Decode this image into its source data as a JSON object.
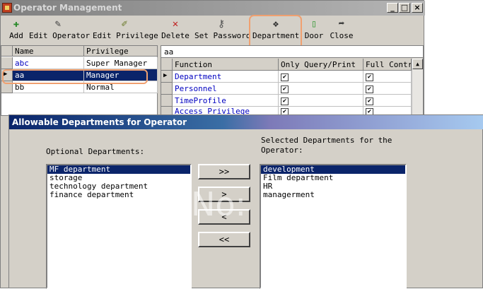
{
  "window": {
    "title": "Operator Management",
    "controls": [
      "_",
      "□",
      "×"
    ]
  },
  "toolbar": [
    {
      "label": "Add",
      "icon": "add-icon",
      "glyph": "✚"
    },
    {
      "label": "Edit Operator",
      "icon": "edit-operator-icon",
      "glyph": "✎"
    },
    {
      "label": "Edit Privilege",
      "icon": "edit-privilege-icon",
      "glyph": "✐"
    },
    {
      "label": "Delete",
      "icon": "delete-icon",
      "glyph": "✕"
    },
    {
      "label": "Set Password",
      "icon": "key-icon",
      "glyph": "⚷"
    },
    {
      "label": "Department",
      "icon": "department-icon",
      "glyph": "❖"
    },
    {
      "label": "Door",
      "icon": "door-icon",
      "glyph": "▯"
    },
    {
      "label": "Close",
      "icon": "close-arrow-icon",
      "glyph": "➦"
    }
  ],
  "operators": {
    "columns": [
      "Name",
      "Privilege"
    ],
    "rows": [
      {
        "name": "abc",
        "privilege": "Super Manager"
      },
      {
        "name": "aa",
        "privilege": "Manager"
      },
      {
        "name": "bb",
        "privilege": "Normal"
      }
    ]
  },
  "permissions": {
    "operator": "aa",
    "columns": [
      "Function",
      "Only Query/Print",
      "Full Control"
    ],
    "rows": [
      {
        "function": "Department",
        "query": "✔",
        "full": "✔"
      },
      {
        "function": "Personnel",
        "query": "✔",
        "full": "✔"
      },
      {
        "function": "TimeProfile",
        "query": "✔",
        "full": "✔"
      },
      {
        "function": "Access Privilege",
        "query": "✔",
        "full": "✔"
      }
    ]
  },
  "dialog": {
    "title": "Allowable Departments for Operator",
    "optional_label": "Optional Departments:",
    "selected_label_1": "Selected Departments for the",
    "selected_label_2": "Operator:",
    "optional": [
      "MF department",
      "storage",
      "technology department",
      "finance department"
    ],
    "selected": [
      "development",
      "Film department",
      "HR",
      "managerment"
    ],
    "buttons": {
      "add_all": ">>",
      "add": ">",
      "remove": "<",
      "remove_all": "<<"
    },
    "watermark": "No:"
  },
  "colors": {
    "selection": "#0a246a",
    "highlight": "#f0a070",
    "chrome": "#d4d0c8"
  }
}
